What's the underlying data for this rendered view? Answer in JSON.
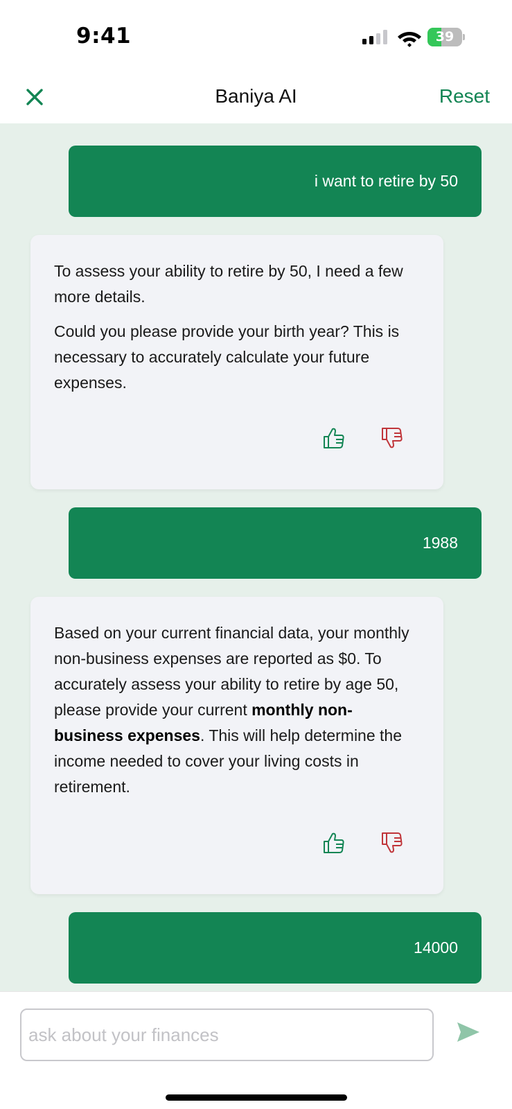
{
  "status_bar": {
    "time": "9:41",
    "battery_level": "39",
    "battery_fraction": 0.39,
    "icons": [
      "signal-icon",
      "wifi-icon",
      "battery-icon"
    ]
  },
  "header": {
    "title": "Baniya AI",
    "reset_label": "Reset",
    "close_icon": "close-icon"
  },
  "messages": [
    {
      "role": "user",
      "text": "i want to retire by 50"
    },
    {
      "role": "assistant",
      "paragraphs": [
        "To assess your ability to retire by 50, I need a few more details.",
        "Could you please provide your birth year? This is necessary to accurately calculate your future expenses."
      ]
    },
    {
      "role": "user",
      "text": "1988"
    },
    {
      "role": "assistant",
      "paragraphs": [
        {
          "before": "Based on your current financial data, your monthly non-business expenses are reported as $0. To accurately assess your ability to retire by age 50, please provide your current ",
          "bold": "monthly non-business expenses",
          "after": ". This will help determine the income needed to cover your living costs in retirement."
        }
      ]
    },
    {
      "role": "user",
      "text": "14000"
    }
  ],
  "feedback": {
    "up_icon": "thumbs-up-icon",
    "down_icon": "thumbs-down-icon"
  },
  "input": {
    "placeholder": "ask about your finances",
    "value": ""
  },
  "send_icon": "send-icon",
  "colors": {
    "accent": "#138554",
    "chat_bg": "#e6f0ea",
    "ai_bubble": "#f2f3f7",
    "thumbs_up": "#138554",
    "thumbs_down": "#c0353a",
    "send_disabled": "#8fc5a8"
  }
}
